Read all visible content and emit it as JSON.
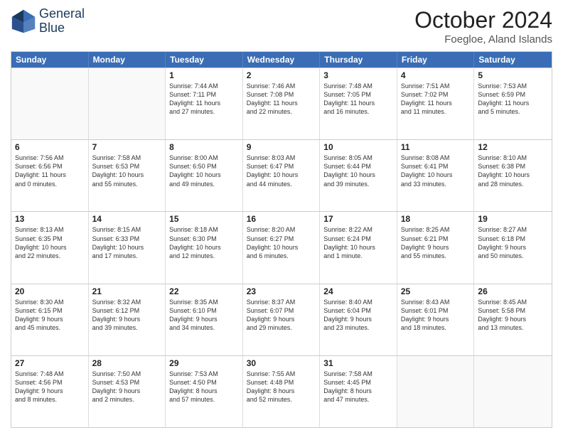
{
  "logo": {
    "line1": "General",
    "line2": "Blue"
  },
  "title": "October 2024",
  "subtitle": "Foegloe, Aland Islands",
  "days": [
    "Sunday",
    "Monday",
    "Tuesday",
    "Wednesday",
    "Thursday",
    "Friday",
    "Saturday"
  ],
  "rows": [
    [
      {
        "num": "",
        "info": ""
      },
      {
        "num": "",
        "info": ""
      },
      {
        "num": "1",
        "info": "Sunrise: 7:44 AM\nSunset: 7:11 PM\nDaylight: 11 hours\nand 27 minutes."
      },
      {
        "num": "2",
        "info": "Sunrise: 7:46 AM\nSunset: 7:08 PM\nDaylight: 11 hours\nand 22 minutes."
      },
      {
        "num": "3",
        "info": "Sunrise: 7:48 AM\nSunset: 7:05 PM\nDaylight: 11 hours\nand 16 minutes."
      },
      {
        "num": "4",
        "info": "Sunrise: 7:51 AM\nSunset: 7:02 PM\nDaylight: 11 hours\nand 11 minutes."
      },
      {
        "num": "5",
        "info": "Sunrise: 7:53 AM\nSunset: 6:59 PM\nDaylight: 11 hours\nand 5 minutes."
      }
    ],
    [
      {
        "num": "6",
        "info": "Sunrise: 7:56 AM\nSunset: 6:56 PM\nDaylight: 11 hours\nand 0 minutes."
      },
      {
        "num": "7",
        "info": "Sunrise: 7:58 AM\nSunset: 6:53 PM\nDaylight: 10 hours\nand 55 minutes."
      },
      {
        "num": "8",
        "info": "Sunrise: 8:00 AM\nSunset: 6:50 PM\nDaylight: 10 hours\nand 49 minutes."
      },
      {
        "num": "9",
        "info": "Sunrise: 8:03 AM\nSunset: 6:47 PM\nDaylight: 10 hours\nand 44 minutes."
      },
      {
        "num": "10",
        "info": "Sunrise: 8:05 AM\nSunset: 6:44 PM\nDaylight: 10 hours\nand 39 minutes."
      },
      {
        "num": "11",
        "info": "Sunrise: 8:08 AM\nSunset: 6:41 PM\nDaylight: 10 hours\nand 33 minutes."
      },
      {
        "num": "12",
        "info": "Sunrise: 8:10 AM\nSunset: 6:38 PM\nDaylight: 10 hours\nand 28 minutes."
      }
    ],
    [
      {
        "num": "13",
        "info": "Sunrise: 8:13 AM\nSunset: 6:35 PM\nDaylight: 10 hours\nand 22 minutes."
      },
      {
        "num": "14",
        "info": "Sunrise: 8:15 AM\nSunset: 6:33 PM\nDaylight: 10 hours\nand 17 minutes."
      },
      {
        "num": "15",
        "info": "Sunrise: 8:18 AM\nSunset: 6:30 PM\nDaylight: 10 hours\nand 12 minutes."
      },
      {
        "num": "16",
        "info": "Sunrise: 8:20 AM\nSunset: 6:27 PM\nDaylight: 10 hours\nand 6 minutes."
      },
      {
        "num": "17",
        "info": "Sunrise: 8:22 AM\nSunset: 6:24 PM\nDaylight: 10 hours\nand 1 minute."
      },
      {
        "num": "18",
        "info": "Sunrise: 8:25 AM\nSunset: 6:21 PM\nDaylight: 9 hours\nand 55 minutes."
      },
      {
        "num": "19",
        "info": "Sunrise: 8:27 AM\nSunset: 6:18 PM\nDaylight: 9 hours\nand 50 minutes."
      }
    ],
    [
      {
        "num": "20",
        "info": "Sunrise: 8:30 AM\nSunset: 6:15 PM\nDaylight: 9 hours\nand 45 minutes."
      },
      {
        "num": "21",
        "info": "Sunrise: 8:32 AM\nSunset: 6:12 PM\nDaylight: 9 hours\nand 39 minutes."
      },
      {
        "num": "22",
        "info": "Sunrise: 8:35 AM\nSunset: 6:10 PM\nDaylight: 9 hours\nand 34 minutes."
      },
      {
        "num": "23",
        "info": "Sunrise: 8:37 AM\nSunset: 6:07 PM\nDaylight: 9 hours\nand 29 minutes."
      },
      {
        "num": "24",
        "info": "Sunrise: 8:40 AM\nSunset: 6:04 PM\nDaylight: 9 hours\nand 23 minutes."
      },
      {
        "num": "25",
        "info": "Sunrise: 8:43 AM\nSunset: 6:01 PM\nDaylight: 9 hours\nand 18 minutes."
      },
      {
        "num": "26",
        "info": "Sunrise: 8:45 AM\nSunset: 5:58 PM\nDaylight: 9 hours\nand 13 minutes."
      }
    ],
    [
      {
        "num": "27",
        "info": "Sunrise: 7:48 AM\nSunset: 4:56 PM\nDaylight: 9 hours\nand 8 minutes."
      },
      {
        "num": "28",
        "info": "Sunrise: 7:50 AM\nSunset: 4:53 PM\nDaylight: 9 hours\nand 2 minutes."
      },
      {
        "num": "29",
        "info": "Sunrise: 7:53 AM\nSunset: 4:50 PM\nDaylight: 8 hours\nand 57 minutes."
      },
      {
        "num": "30",
        "info": "Sunrise: 7:55 AM\nSunset: 4:48 PM\nDaylight: 8 hours\nand 52 minutes."
      },
      {
        "num": "31",
        "info": "Sunrise: 7:58 AM\nSunset: 4:45 PM\nDaylight: 8 hours\nand 47 minutes."
      },
      {
        "num": "",
        "info": ""
      },
      {
        "num": "",
        "info": ""
      }
    ]
  ]
}
